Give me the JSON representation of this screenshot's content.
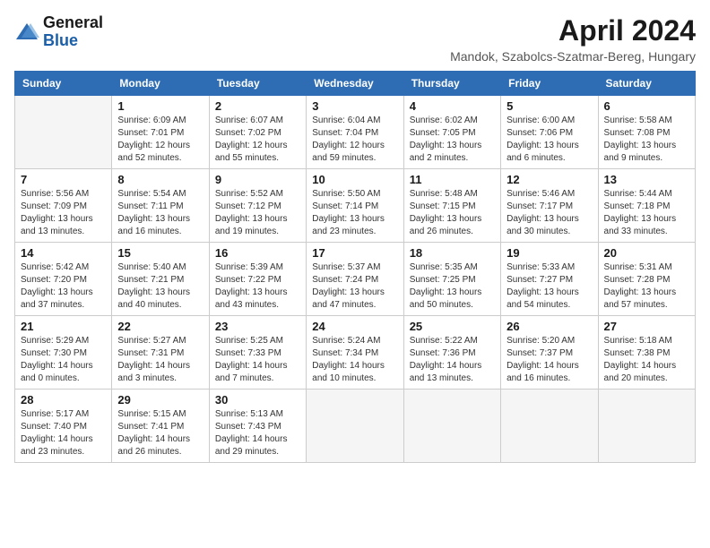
{
  "logo": {
    "general": "General",
    "blue": "Blue"
  },
  "title": "April 2024",
  "subtitle": "Mandok, Szabolcs-Szatmar-Bereg, Hungary",
  "days_of_week": [
    "Sunday",
    "Monday",
    "Tuesday",
    "Wednesday",
    "Thursday",
    "Friday",
    "Saturday"
  ],
  "weeks": [
    [
      {
        "day": "",
        "empty": true
      },
      {
        "day": "1",
        "sunrise": "Sunrise: 6:09 AM",
        "sunset": "Sunset: 7:01 PM",
        "daylight": "Daylight: 12 hours and 52 minutes."
      },
      {
        "day": "2",
        "sunrise": "Sunrise: 6:07 AM",
        "sunset": "Sunset: 7:02 PM",
        "daylight": "Daylight: 12 hours and 55 minutes."
      },
      {
        "day": "3",
        "sunrise": "Sunrise: 6:04 AM",
        "sunset": "Sunset: 7:04 PM",
        "daylight": "Daylight: 12 hours and 59 minutes."
      },
      {
        "day": "4",
        "sunrise": "Sunrise: 6:02 AM",
        "sunset": "Sunset: 7:05 PM",
        "daylight": "Daylight: 13 hours and 2 minutes."
      },
      {
        "day": "5",
        "sunrise": "Sunrise: 6:00 AM",
        "sunset": "Sunset: 7:06 PM",
        "daylight": "Daylight: 13 hours and 6 minutes."
      },
      {
        "day": "6",
        "sunrise": "Sunrise: 5:58 AM",
        "sunset": "Sunset: 7:08 PM",
        "daylight": "Daylight: 13 hours and 9 minutes."
      }
    ],
    [
      {
        "day": "7",
        "sunrise": "Sunrise: 5:56 AM",
        "sunset": "Sunset: 7:09 PM",
        "daylight": "Daylight: 13 hours and 13 minutes."
      },
      {
        "day": "8",
        "sunrise": "Sunrise: 5:54 AM",
        "sunset": "Sunset: 7:11 PM",
        "daylight": "Daylight: 13 hours and 16 minutes."
      },
      {
        "day": "9",
        "sunrise": "Sunrise: 5:52 AM",
        "sunset": "Sunset: 7:12 PM",
        "daylight": "Daylight: 13 hours and 19 minutes."
      },
      {
        "day": "10",
        "sunrise": "Sunrise: 5:50 AM",
        "sunset": "Sunset: 7:14 PM",
        "daylight": "Daylight: 13 hours and 23 minutes."
      },
      {
        "day": "11",
        "sunrise": "Sunrise: 5:48 AM",
        "sunset": "Sunset: 7:15 PM",
        "daylight": "Daylight: 13 hours and 26 minutes."
      },
      {
        "day": "12",
        "sunrise": "Sunrise: 5:46 AM",
        "sunset": "Sunset: 7:17 PM",
        "daylight": "Daylight: 13 hours and 30 minutes."
      },
      {
        "day": "13",
        "sunrise": "Sunrise: 5:44 AM",
        "sunset": "Sunset: 7:18 PM",
        "daylight": "Daylight: 13 hours and 33 minutes."
      }
    ],
    [
      {
        "day": "14",
        "sunrise": "Sunrise: 5:42 AM",
        "sunset": "Sunset: 7:20 PM",
        "daylight": "Daylight: 13 hours and 37 minutes."
      },
      {
        "day": "15",
        "sunrise": "Sunrise: 5:40 AM",
        "sunset": "Sunset: 7:21 PM",
        "daylight": "Daylight: 13 hours and 40 minutes."
      },
      {
        "day": "16",
        "sunrise": "Sunrise: 5:39 AM",
        "sunset": "Sunset: 7:22 PM",
        "daylight": "Daylight: 13 hours and 43 minutes."
      },
      {
        "day": "17",
        "sunrise": "Sunrise: 5:37 AM",
        "sunset": "Sunset: 7:24 PM",
        "daylight": "Daylight: 13 hours and 47 minutes."
      },
      {
        "day": "18",
        "sunrise": "Sunrise: 5:35 AM",
        "sunset": "Sunset: 7:25 PM",
        "daylight": "Daylight: 13 hours and 50 minutes."
      },
      {
        "day": "19",
        "sunrise": "Sunrise: 5:33 AM",
        "sunset": "Sunset: 7:27 PM",
        "daylight": "Daylight: 13 hours and 54 minutes."
      },
      {
        "day": "20",
        "sunrise": "Sunrise: 5:31 AM",
        "sunset": "Sunset: 7:28 PM",
        "daylight": "Daylight: 13 hours and 57 minutes."
      }
    ],
    [
      {
        "day": "21",
        "sunrise": "Sunrise: 5:29 AM",
        "sunset": "Sunset: 7:30 PM",
        "daylight": "Daylight: 14 hours and 0 minutes."
      },
      {
        "day": "22",
        "sunrise": "Sunrise: 5:27 AM",
        "sunset": "Sunset: 7:31 PM",
        "daylight": "Daylight: 14 hours and 3 minutes."
      },
      {
        "day": "23",
        "sunrise": "Sunrise: 5:25 AM",
        "sunset": "Sunset: 7:33 PM",
        "daylight": "Daylight: 14 hours and 7 minutes."
      },
      {
        "day": "24",
        "sunrise": "Sunrise: 5:24 AM",
        "sunset": "Sunset: 7:34 PM",
        "daylight": "Daylight: 14 hours and 10 minutes."
      },
      {
        "day": "25",
        "sunrise": "Sunrise: 5:22 AM",
        "sunset": "Sunset: 7:36 PM",
        "daylight": "Daylight: 14 hours and 13 minutes."
      },
      {
        "day": "26",
        "sunrise": "Sunrise: 5:20 AM",
        "sunset": "Sunset: 7:37 PM",
        "daylight": "Daylight: 14 hours and 16 minutes."
      },
      {
        "day": "27",
        "sunrise": "Sunrise: 5:18 AM",
        "sunset": "Sunset: 7:38 PM",
        "daylight": "Daylight: 14 hours and 20 minutes."
      }
    ],
    [
      {
        "day": "28",
        "sunrise": "Sunrise: 5:17 AM",
        "sunset": "Sunset: 7:40 PM",
        "daylight": "Daylight: 14 hours and 23 minutes."
      },
      {
        "day": "29",
        "sunrise": "Sunrise: 5:15 AM",
        "sunset": "Sunset: 7:41 PM",
        "daylight": "Daylight: 14 hours and 26 minutes."
      },
      {
        "day": "30",
        "sunrise": "Sunrise: 5:13 AM",
        "sunset": "Sunset: 7:43 PM",
        "daylight": "Daylight: 14 hours and 29 minutes."
      },
      {
        "day": "",
        "empty": true
      },
      {
        "day": "",
        "empty": true
      },
      {
        "day": "",
        "empty": true
      },
      {
        "day": "",
        "empty": true
      }
    ]
  ]
}
